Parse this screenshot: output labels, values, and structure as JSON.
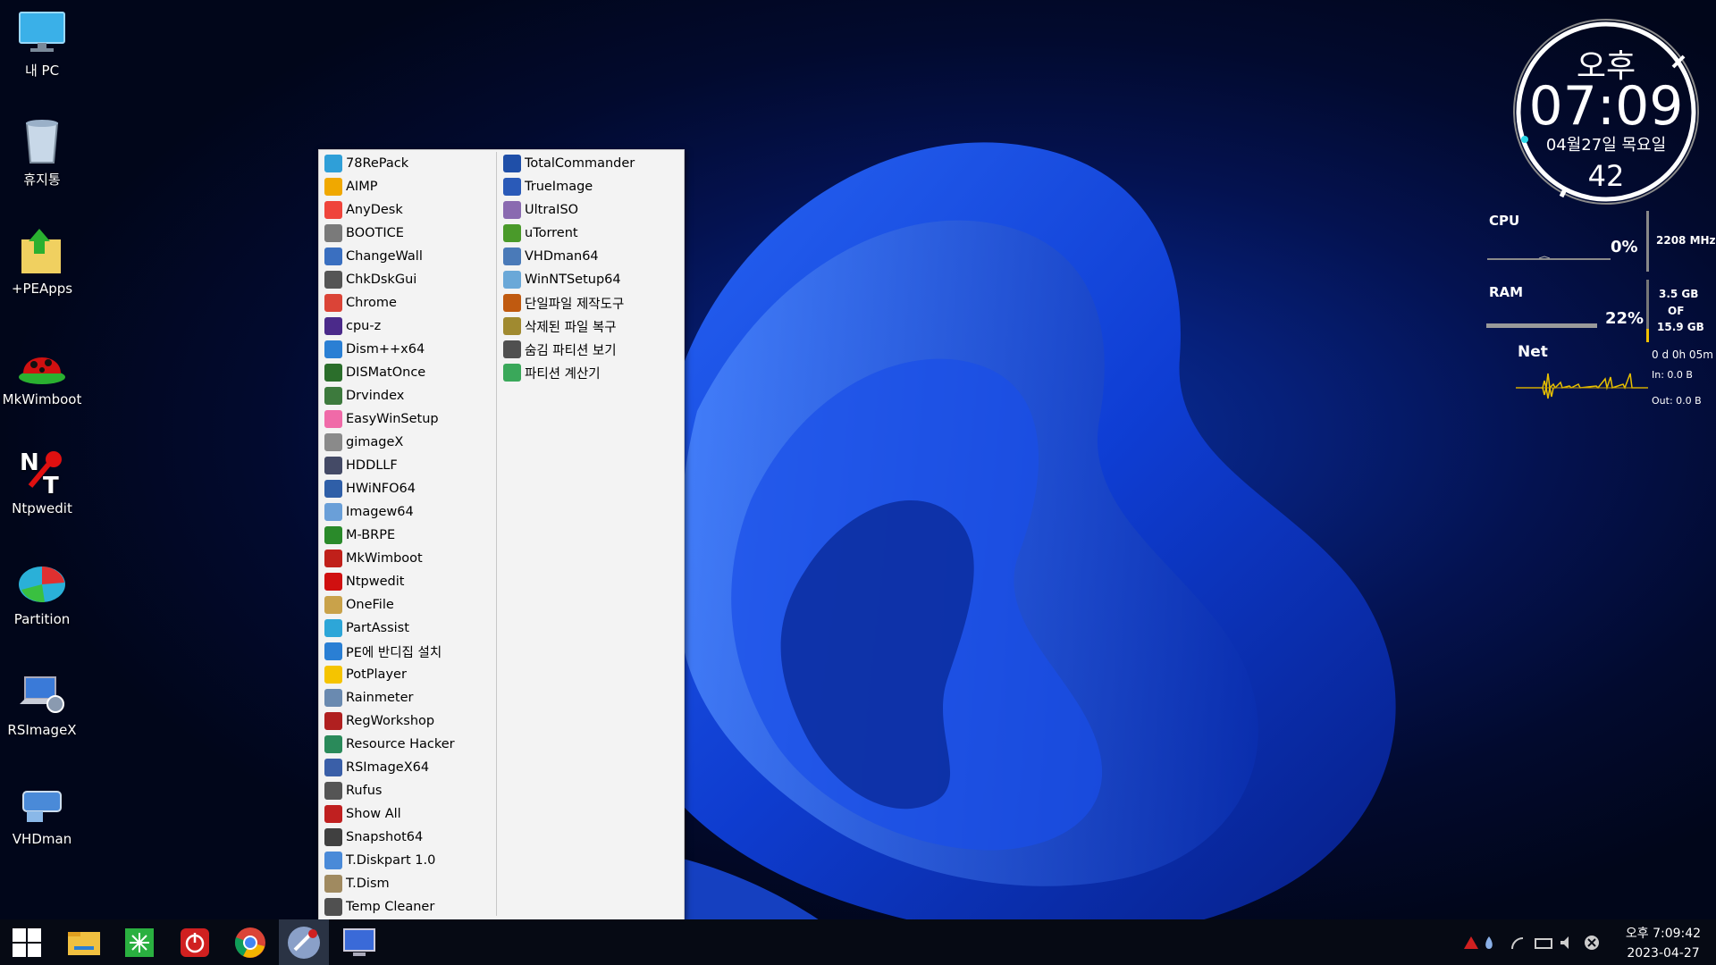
{
  "desktop_icons": [
    {
      "label": "내 PC",
      "icon": "monitor-icon"
    },
    {
      "label": "휴지통",
      "icon": "recycle-bin-icon"
    },
    {
      "label": "+PEApps",
      "icon": "folder-icon"
    },
    {
      "label": "MkWimboot",
      "icon": "ladybug-icon"
    },
    {
      "label": "Ntpwedit",
      "icon": "key-icon"
    },
    {
      "label": "Partition",
      "icon": "partition-icon"
    },
    {
      "label": "RSImageX",
      "icon": "laptop-gear-icon"
    },
    {
      "label": "VHDman",
      "icon": "vhd-icon"
    }
  ],
  "menu": {
    "column1": [
      {
        "label": "78RePack",
        "color": "#2f9fd8"
      },
      {
        "label": "AIMP",
        "color": "#f0a800"
      },
      {
        "label": "AnyDesk",
        "color": "#ef443b"
      },
      {
        "label": "BOOTICE",
        "color": "#7a7a7a"
      },
      {
        "label": "ChangeWall",
        "color": "#3a6fc0"
      },
      {
        "label": "ChkDskGui",
        "color": "#555555"
      },
      {
        "label": "Chrome",
        "color": "#db4437"
      },
      {
        "label": "cpu-z",
        "color": "#4b2a8a"
      },
      {
        "label": "Dism++x64",
        "color": "#2a7fd4"
      },
      {
        "label": "DISMatOnce",
        "color": "#2b6e2b"
      },
      {
        "label": "Drvindex",
        "color": "#3d7a3d"
      },
      {
        "label": "EasyWinSetup",
        "color": "#f06aa8"
      },
      {
        "label": "gimageX",
        "color": "#8a8a8a"
      },
      {
        "label": "HDDLLF",
        "color": "#444a66"
      },
      {
        "label": "HWiNFO64",
        "color": "#2f5fa8"
      },
      {
        "label": "Imagew64",
        "color": "#6a9fd8"
      },
      {
        "label": "M-BRPE",
        "color": "#2a8a2a"
      },
      {
        "label": "MkWimboot",
        "color": "#c0201a"
      },
      {
        "label": "Ntpwedit",
        "color": "#d01010"
      },
      {
        "label": "OneFile",
        "color": "#c9a24a"
      },
      {
        "label": "PartAssist",
        "color": "#2da6d8"
      },
      {
        "label": "PE에 반디집 설치",
        "color": "#2a7fd4"
      },
      {
        "label": "PotPlayer",
        "color": "#f5c400"
      },
      {
        "label": "Rainmeter",
        "color": "#6a8ab0"
      },
      {
        "label": "RegWorkshop",
        "color": "#b02020"
      },
      {
        "label": "Resource Hacker",
        "color": "#2a8a5a"
      },
      {
        "label": "RSImageX64",
        "color": "#3a5fa8"
      },
      {
        "label": "Rufus",
        "color": "#555555"
      },
      {
        "label": "Show All",
        "color": "#c02020"
      },
      {
        "label": "Snapshot64",
        "color": "#404040"
      },
      {
        "label": "T.Diskpart 1.0",
        "color": "#4a8ad8"
      },
      {
        "label": "T.Dism",
        "color": "#a08a60"
      },
      {
        "label": "Temp Cleaner",
        "color": "#505050"
      }
    ],
    "column2": [
      {
        "label": "TotalCommander",
        "color": "#1f4fa8"
      },
      {
        "label": "TrueImage",
        "color": "#2a5ab8"
      },
      {
        "label": "UltraISO",
        "color": "#8a6ab0"
      },
      {
        "label": "uTorrent",
        "color": "#4a9a2a"
      },
      {
        "label": "VHDman64",
        "color": "#4a7ab8"
      },
      {
        "label": "WinNTSetup64",
        "color": "#6aa8d8"
      },
      {
        "label": "단일파일 제작도구",
        "color": "#c05a10"
      },
      {
        "label": "삭제된 파일 복구",
        "color": "#a08a30"
      },
      {
        "label": "숨김 파티션 보기",
        "color": "#505050"
      },
      {
        "label": "파티션 계산기",
        "color": "#3aa85a"
      }
    ]
  },
  "clock_widget": {
    "ampm": "오후",
    "time": "07:09",
    "date": "04월27일 목요일",
    "seconds": "42"
  },
  "system_widget": {
    "cpu_label": "CPU",
    "cpu_percent": "0%",
    "cpu_freq": "2208 MHz",
    "ram_label": "RAM",
    "ram_percent": "22%",
    "ram_used": "3.5 GB",
    "ram_of": "OF",
    "ram_total": "15.9 GB",
    "net_label": "Net",
    "uptime": "0 d 0h 05m",
    "net_in": "In: 0.0 B",
    "net_out": "Out: 0.0 B"
  },
  "taskbar": {
    "buttons": [
      "start-icon",
      "file-explorer-icon",
      "green-app-icon",
      "power-icon",
      "chrome-icon",
      "launcher-icon",
      "computer-icon"
    ],
    "clock_time": "오후 7:09:42",
    "clock_date": "2023-04-27"
  }
}
